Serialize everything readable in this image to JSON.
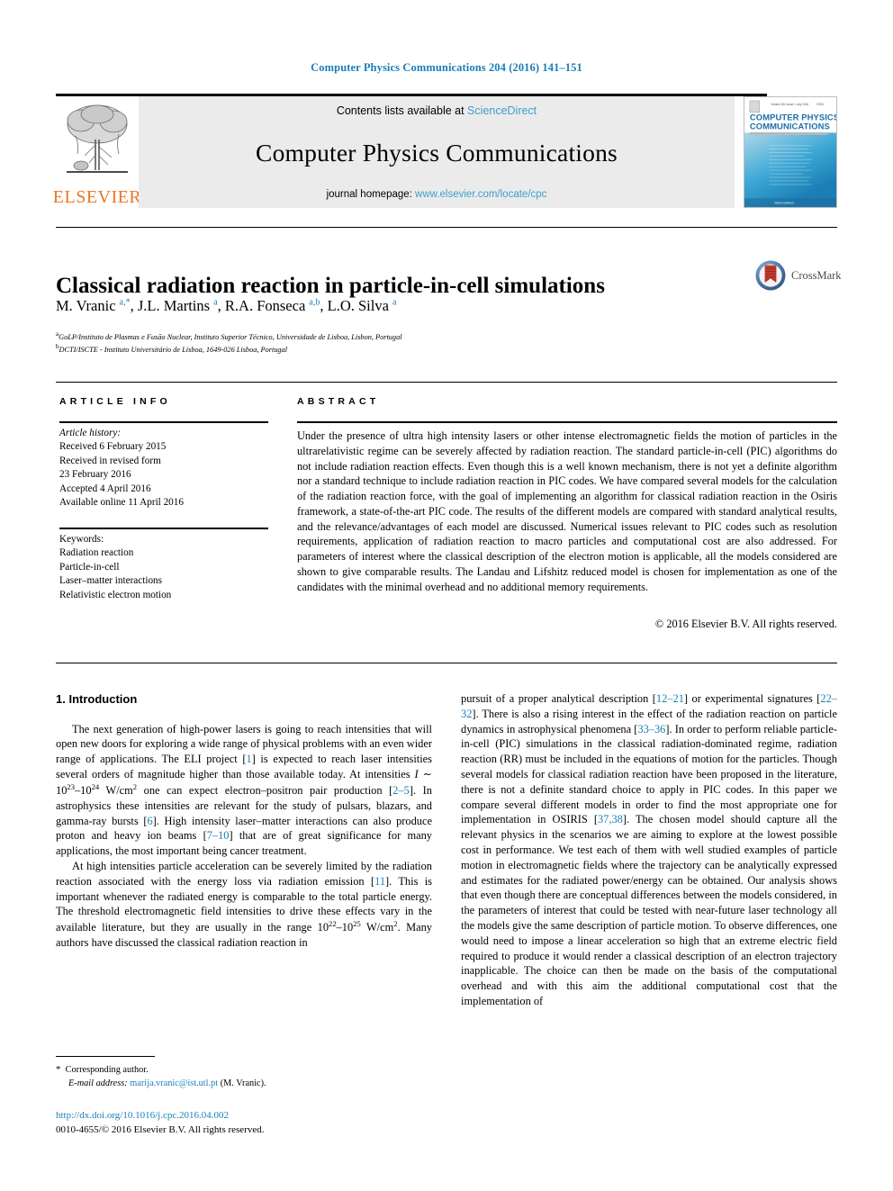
{
  "running_head": "Computer Physics Communications 204 (2016) 141–151",
  "masthead": {
    "publisher_logo_label": "ELSEVIER",
    "contents_prefix": "Contents lists available at ",
    "contents_link": "ScienceDirect",
    "journal_title": "Computer Physics Communications",
    "homepage_prefix": "journal homepage: ",
    "homepage_url": "www.elsevier.com/locate/cpc",
    "cover_line1": "COMPUTER PHYSICS",
    "cover_line2": "COMMUNICATIONS"
  },
  "article": {
    "title": "Classical radiation reaction in particle-in-cell simulations",
    "authors_html": "M. Vranic <sup>a,*</sup>, J.L. Martins <sup>a</sup>, R.A. Fonseca <sup>a,b</sup>, L.O. Silva <sup>a</sup>",
    "affiliation_a": "GoLP/Instituto de Plasmas e Fusão Nuclear, Instituto Superior Técnico, Universidade de Lisboa, Lisbon, Portugal",
    "affiliation_b": "DCTI/ISCTE - Instituto Universitário de Lisboa, 1649-026 Lisboa, Portugal",
    "affil_marker_a": "a",
    "affil_marker_b": "b",
    "crossmark_label": "CrossMark"
  },
  "article_info": {
    "heading": "ARTICLE INFO",
    "history_label": "Article history:",
    "history": [
      "Received 6 February 2015",
      "Received in revised form",
      "23 February 2016",
      "Accepted 4 April 2016",
      "Available online 11 April 2016"
    ],
    "keywords_label": "Keywords:",
    "keywords": [
      "Radiation reaction",
      "Particle-in-cell",
      "Laser–matter interactions",
      "Relativistic electron motion"
    ]
  },
  "abstract": {
    "heading": "ABSTRACT",
    "text": "Under the presence of ultra high intensity lasers or other intense electromagnetic fields the motion of particles in the ultrarelativistic regime can be severely affected by radiation reaction. The standard particle-in-cell (PIC) algorithms do not include radiation reaction effects. Even though this is a well known mechanism, there is not yet a definite algorithm nor a standard technique to include radiation reaction in PIC codes. We have compared several models for the calculation of the radiation reaction force, with the goal of implementing an algorithm for classical radiation reaction in the Osiris framework, a state-of-the-art PIC code. The results of the different models are compared with standard analytical results, and the relevance/advantages of each model are discussed. Numerical issues relevant to PIC codes such as resolution requirements, application of radiation reaction to macro particles and computational cost are also addressed. For parameters of interest where the classical description of the electron motion is applicable, all the models considered are shown to give comparable results. The Landau and Lifshitz reduced model is chosen for implementation as one of the candidates with the minimal overhead and no additional memory requirements.",
    "copyright": "© 2016 Elsevier B.V. All rights reserved."
  },
  "body": {
    "section_heading": "1. Introduction",
    "left_p1_html": "The next generation of high-power lasers is going to reach intensities that will open new doors for exploring a wide range of physical problems with an even wider range of applications. The ELI project [<span class=\"ref\">1</span>] is expected to reach laser intensities several orders of magnitude higher than those available today. At intensities <i>I</i> ∼ 10<sup class=\"num\">23</sup>–10<sup class=\"num\">24</sup> W/cm<sup class=\"num\">2</sup> one can expect electron–positron pair production [<span class=\"ref\">2–5</span>]. In astrophysics these intensities are relevant for the study of pulsars, blazars, and gamma-ray bursts [<span class=\"ref\">6</span>]. High intensity laser–matter interactions can also produce proton and heavy ion beams [<span class=\"ref\">7–10</span>] that are of great significance for many applications, the most important being cancer treatment.",
    "left_p2_html": "At high intensities particle acceleration can be severely limited by the radiation reaction associated with the energy loss via radiation emission [<span class=\"ref\">11</span>]. This is important whenever the radiated energy is comparable to the total particle energy. The threshold electromagnetic field intensities to drive these effects vary in the available literature, but they are usually in the range 10<sup class=\"num\">22</sup>–10<sup class=\"num\">25</sup> W/cm<sup class=\"num\">2</sup>. Many authors have discussed the classical radiation reaction in",
    "right_p1_html": "pursuit of a proper analytical description [<span class=\"ref\">12–21</span>] or experimental signatures [<span class=\"ref\">22–32</span>]. There is also a rising interest in the effect of the radiation reaction on particle dynamics in astrophysical phenomena [<span class=\"ref\">33–36</span>]. In order to perform reliable particle-in-cell (PIC) simulations in the classical radiation-dominated regime, radiation reaction (RR) must be included in the equations of motion for the particles. Though several models for classical radiation reaction have been proposed in the literature, there is not a definite standard choice to apply in PIC codes. In this paper we compare several different models in order to find the most appropriate one for implementation in OSIRIS [<span class=\"ref\">37,38</span>].  The chosen model should capture all the relevant physics in the scenarios we are aiming to explore at the lowest possible cost in performance. We test each of them with well studied examples of particle motion in electromagnetic fields where the trajectory can be analytically expressed and estimates for the radiated power/energy can be obtained. Our analysis shows that even though there are conceptual differences between the models considered, in the parameters of interest that could be tested with near-future laser technology all the models give the same description of particle motion. To observe differences, one would need to impose a linear acceleration so high that an extreme electric field required to produce it would render a classical description of an electron trajectory inapplicable. The choice can then be made on the basis of the computational overhead and with this aim the additional computational cost that the implementation of"
  },
  "footer": {
    "corresponding_marker": "*",
    "corresponding_label": "Corresponding author.",
    "email_label": "E-mail address:",
    "email": "marija.vranic@ist.utl.pt",
    "email_suffix": "(M. Vranic).",
    "doi": "http://dx.doi.org/10.1016/j.cpc.2016.04.002",
    "issn_line": "0010-4655/© 2016 Elsevier B.V. All rights reserved."
  },
  "colors": {
    "link_blue": "#1b7fb5",
    "sciencedirect_blue": "#3e9ecb",
    "elsevier_orange": "#E87722",
    "masthead_grey": "#ebebeb"
  }
}
